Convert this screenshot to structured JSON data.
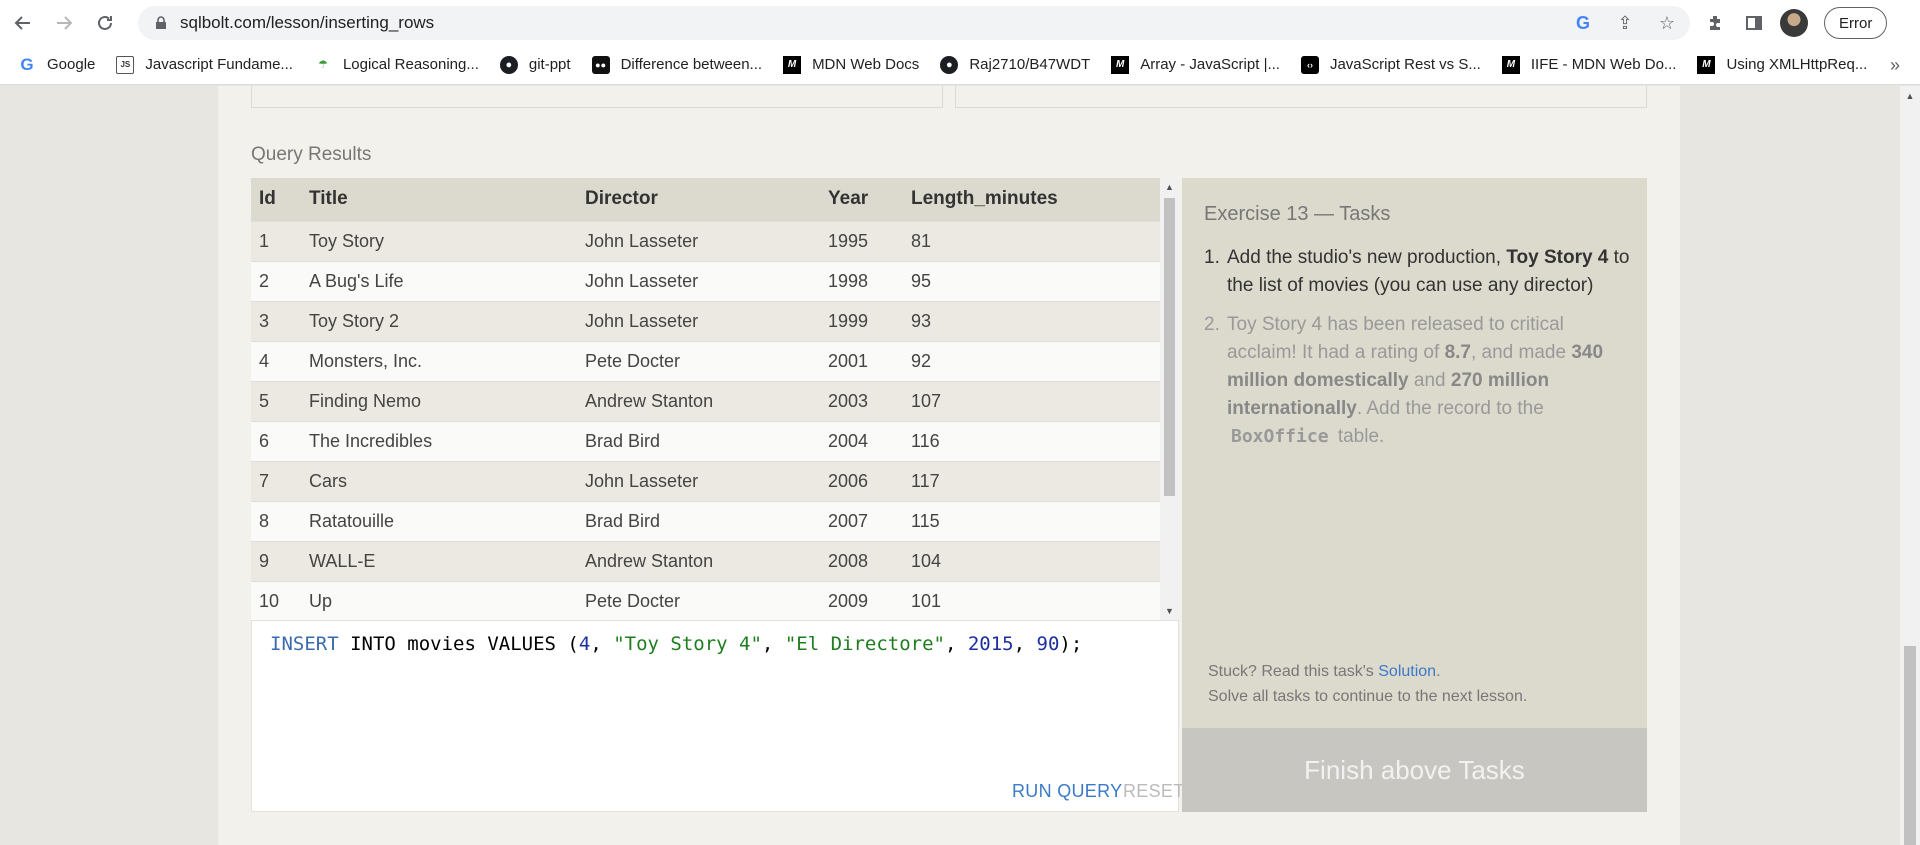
{
  "browser": {
    "url": "sqlbolt.com/lesson/inserting_rows",
    "error_label": "Error",
    "bookmarks": [
      {
        "label": "Google",
        "icon": "google-icon"
      },
      {
        "label": "Javascript Fundame...",
        "icon": "js-doc-icon"
      },
      {
        "label": "Logical Reasoning...",
        "icon": "leaf-icon"
      },
      {
        "label": "git-ppt",
        "icon": "github-icon"
      },
      {
        "label": "Difference between...",
        "icon": "medium-icon"
      },
      {
        "label": "MDN Web Docs",
        "icon": "mdn-icon"
      },
      {
        "label": "Raj2710/B47WDT",
        "icon": "github-icon"
      },
      {
        "label": "Array - JavaScript |...",
        "icon": "mdn-icon"
      },
      {
        "label": "JavaScript Rest vs S...",
        "icon": "code-icon"
      },
      {
        "label": "IIFE - MDN Web Do...",
        "icon": "mdn-icon"
      },
      {
        "label": "Using XMLHttpReq...",
        "icon": "mdn-icon"
      }
    ],
    "more_bookmarks": "»"
  },
  "results": {
    "label": "Query Results",
    "columns": [
      "Id",
      "Title",
      "Director",
      "Year",
      "Length_minutes"
    ],
    "rows": [
      [
        "1",
        "Toy Story",
        "John Lasseter",
        "1995",
        "81"
      ],
      [
        "2",
        "A Bug's Life",
        "John Lasseter",
        "1998",
        "95"
      ],
      [
        "3",
        "Toy Story 2",
        "John Lasseter",
        "1999",
        "93"
      ],
      [
        "4",
        "Monsters, Inc.",
        "Pete Docter",
        "2001",
        "92"
      ],
      [
        "5",
        "Finding Nemo",
        "Andrew Stanton",
        "2003",
        "107"
      ],
      [
        "6",
        "The Incredibles",
        "Brad Bird",
        "2004",
        "116"
      ],
      [
        "7",
        "Cars",
        "John Lasseter",
        "2006",
        "117"
      ],
      [
        "8",
        "Ratatouille",
        "Brad Bird",
        "2007",
        "115"
      ],
      [
        "9",
        "WALL-E",
        "Andrew Stanton",
        "2008",
        "104"
      ],
      [
        "10",
        "Up",
        "Pete Docter",
        "2009",
        "101"
      ]
    ]
  },
  "editor": {
    "code_kw": "INSERT",
    "code_into": " INTO movies VALUES (",
    "code_n1": "4",
    "code_c1": ", ",
    "code_s1": "\"Toy Story 4\"",
    "code_c2": ", ",
    "code_s2": "\"El Directore\"",
    "code_c3": ", ",
    "code_n2": "2015",
    "code_c4": ", ",
    "code_n3": "90",
    "code_end": ");",
    "run_label": "RUN QUERY",
    "reset_label": "RESET"
  },
  "tasks": {
    "title": "Exercise 13 — Tasks",
    "t1_num": "1.",
    "t1_a": "Add the studio's new production, ",
    "t1_b": "Toy Story 4",
    "t1_c": " to the list of movies (you can use any director)",
    "t2_num": "2.",
    "t2_a": "Toy Story 4 has been released to critical acclaim! It had a rating of ",
    "t2_b": "8.7",
    "t2_c": ", and made ",
    "t2_d": "340 million domestically",
    "t2_e": " and ",
    "t2_f": "270 million internationally",
    "t2_g": ". Add the record to the",
    "t2_tag": "BoxOffice",
    "t2_h": "table.",
    "stuck_a": "Stuck? Read this task's ",
    "stuck_link": "Solution",
    "stuck_b": ".",
    "stuck_line2": "Solve all tasks to continue to the next lesson.",
    "finish_label": "Finish above Tasks"
  }
}
